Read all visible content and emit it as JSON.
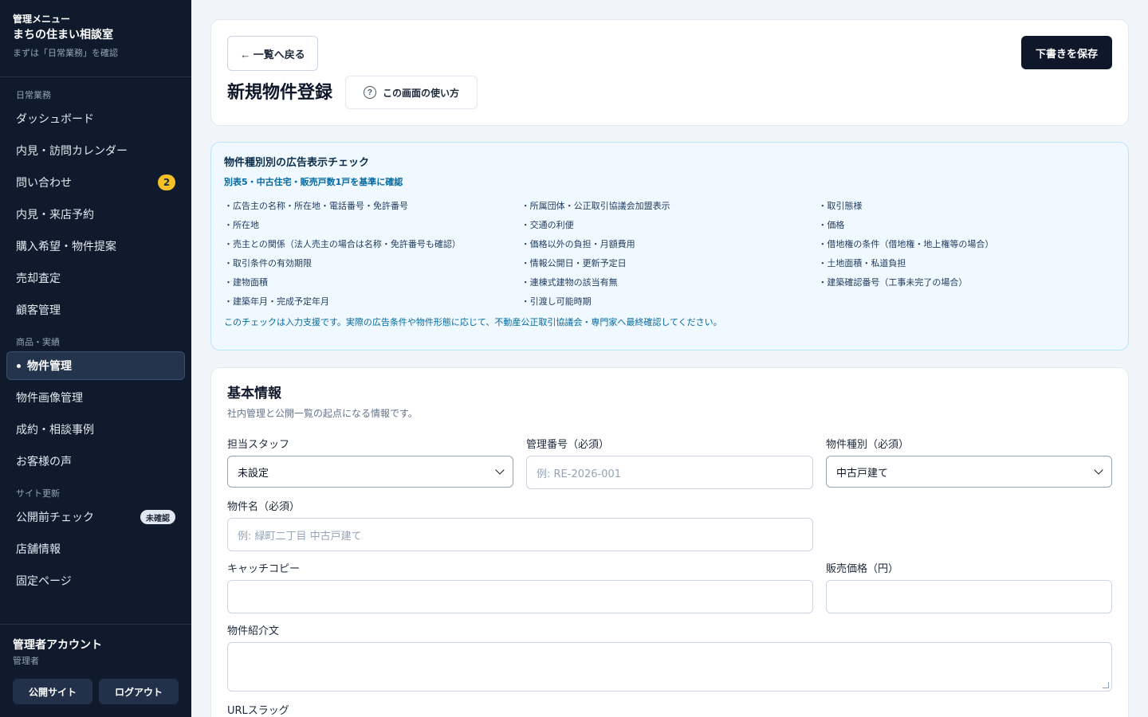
{
  "sidebar": {
    "kicker": "管理メニュー",
    "brand": "まちの住まい相談室",
    "hint": "まずは「日常業務」を確認",
    "sections": [
      {
        "title": "日常業務",
        "items": [
          {
            "label": "ダッシュボード"
          },
          {
            "label": "内見・訪問カレンダー"
          },
          {
            "label": "問い合わせ",
            "badge": "2"
          },
          {
            "label": "内見・来店予約"
          },
          {
            "label": "購入希望・物件提案"
          },
          {
            "label": "売却査定"
          },
          {
            "label": "顧客管理"
          }
        ]
      },
      {
        "title": "商品・実績",
        "items": [
          {
            "label": "物件管理",
            "active": true
          },
          {
            "label": "物件画像管理"
          },
          {
            "label": "成約・相談事例"
          },
          {
            "label": "お客様の声"
          }
        ]
      },
      {
        "title": "サイト更新",
        "items": [
          {
            "label": "公開前チェック",
            "badge": "未確認"
          },
          {
            "label": "店舗情報"
          },
          {
            "label": "固定ページ"
          }
        ]
      }
    ],
    "account": {
      "name": "管理者アカウント",
      "role": "管理者",
      "public_site": "公開サイト",
      "logout": "ログアウト"
    }
  },
  "header": {
    "back_label": "← 一覧へ戻る",
    "title": "新規物件登録",
    "help_label": "この画面の使い方",
    "save_label": "下書きを保存"
  },
  "checklist": {
    "title": "物件種別別の広告表示チェック",
    "subtitle": "別表5・中古住宅・販売戸数1戸を基準に確認",
    "columns": [
      [
        "・広告主の名称・所在地・電話番号・免許番号",
        "・所在地",
        "・売主との関係（法人売主の場合は名称・免許番号も確認）",
        "・取引条件の有効期限",
        "・建物面積",
        "・建築年月・完成予定年月"
      ],
      [
        "・所属団体・公正取引協議会加盟表示",
        "・交通の利便",
        "・価格以外の負担・月額費用",
        "・情報公開日・更新予定日",
        "・連棟式建物の該当有無",
        "・引渡し可能時期"
      ],
      [
        "・取引態様",
        "・価格",
        "・借地権の条件（借地権・地上権等の場合）",
        "・土地面積・私道負担",
        "・建築確認番号（工事未完了の場合）"
      ]
    ],
    "note": "このチェックは入力支援です。実際の広告条件や物件形態に応じて、不動産公正取引協議会・専門家へ最終確認してください。"
  },
  "form": {
    "title": "基本情報",
    "description": "社内管理と公開一覧の起点になる情報です。",
    "staff": {
      "label": "担当スタッフ",
      "value": "未設定"
    },
    "code": {
      "label": "管理番号（必須）",
      "placeholder": "例: RE-2026-001"
    },
    "type": {
      "label": "物件種別（必須）",
      "value": "中古戸建て"
    },
    "name": {
      "label": "物件名（必須）",
      "placeholder": "例: 緑町二丁目 中古戸建て"
    },
    "catch": {
      "label": "キャッチコピー"
    },
    "price": {
      "label": "販売価格（円）"
    },
    "intro": {
      "label": "物件紹介文"
    },
    "slug": {
      "label": "URLスラッグ"
    }
  }
}
